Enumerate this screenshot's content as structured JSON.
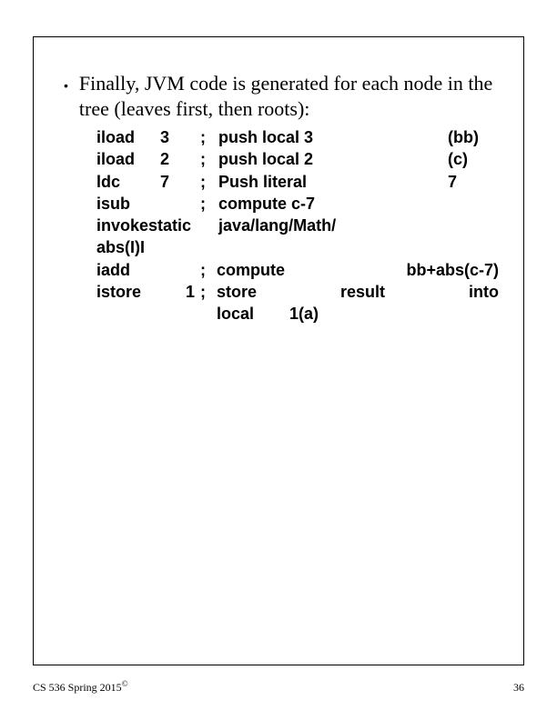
{
  "bullet": {
    "text": "Finally, JVM code is generated for each node in the tree (leaves first, then roots):"
  },
  "code": {
    "l1": {
      "op": "iload",
      "arg": "3",
      "semi": ";",
      "cmt": "push local 3",
      "extra": "(bb)"
    },
    "l2": {
      "op": "iload",
      "arg": "2",
      "semi": ";",
      "cmt": "push local 2",
      "extra": "(c)"
    },
    "l3": {
      "op": "ldc",
      "arg": "7",
      "semi": ";",
      "cmt": "Push literal",
      "extra": "7"
    },
    "l4": {
      "op": "isub",
      "arg": "",
      "semi": ";",
      "cmt": "compute c-7",
      "extra": ""
    },
    "l5": {
      "left": "invokestatic",
      "right": "java/lang/Math/"
    },
    "l5b": {
      "text": "abs(I)I"
    },
    "l6": {
      "op": "iadd",
      "semi": ";",
      "c1": "compute",
      "c2": "bb+abs(c-7)"
    },
    "l7": {
      "op": "istore",
      "arg": "1",
      "semi": ";",
      "c1": "store",
      "c2": "result",
      "c3": "into"
    },
    "l8": {
      "c1": "local",
      "c2": "1(a)"
    }
  },
  "footer": {
    "left": "CS 536  Spring 2015",
    "copy": "©",
    "right": "36"
  }
}
